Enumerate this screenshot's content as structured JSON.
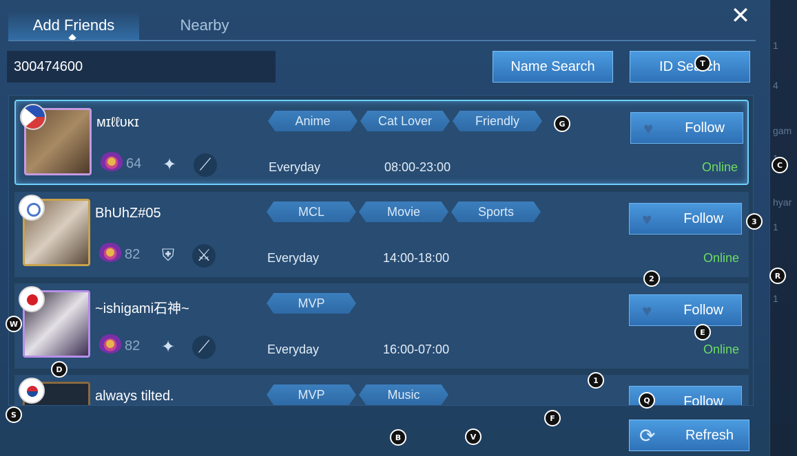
{
  "tabs": [
    {
      "label": "Add Friends",
      "active": true
    },
    {
      "label": "Nearby",
      "active": false
    }
  ],
  "search": {
    "value": "300474600",
    "name_search_label": "Name Search",
    "id_search_label": "ID Search"
  },
  "players": [
    {
      "name": "ᴍɪℓℓᴜᴋɪ",
      "level": "64",
      "flag": "philippines-flag-icon",
      "tags": [
        "Anime",
        "Cat Lover",
        "Friendly"
      ],
      "days": "Everyday",
      "hours": "08:00-23:00",
      "follow_label": "Follow",
      "status": "Online"
    },
    {
      "name": "BhUhZ#05",
      "level": "82",
      "flag": "taiwan-flag-icon",
      "tags": [
        "MCL",
        "Movie",
        "Sports"
      ],
      "days": "Everyday",
      "hours": "14:00-18:00",
      "follow_label": "Follow",
      "status": "Online"
    },
    {
      "name": "~ishigami石神~",
      "level": "82",
      "flag": "japan-flag-icon",
      "tags": [
        "MVP"
      ],
      "days": "Everyday",
      "hours": "16:00-07:00",
      "follow_label": "Follow",
      "status": "Online"
    },
    {
      "name": "always tilted.",
      "flag": "korea-flag-icon",
      "tags": [
        "MVP",
        "Music"
      ],
      "follow_label": "Follow"
    }
  ],
  "refresh_label": "Refresh",
  "sidebar_fragments": [
    "1",
    "4",
    "gam",
    "1",
    "hyar",
    "1",
    "ry",
    "1"
  ],
  "markers": [
    "T",
    "G",
    "C",
    "3",
    "2",
    "R",
    "W",
    "E",
    "D",
    "1",
    "Q",
    "S",
    "F",
    "B",
    "V"
  ],
  "colors": {
    "online": "#6ddc63",
    "accent": "#4b9be0",
    "selected_border": "#6fd0ff"
  }
}
